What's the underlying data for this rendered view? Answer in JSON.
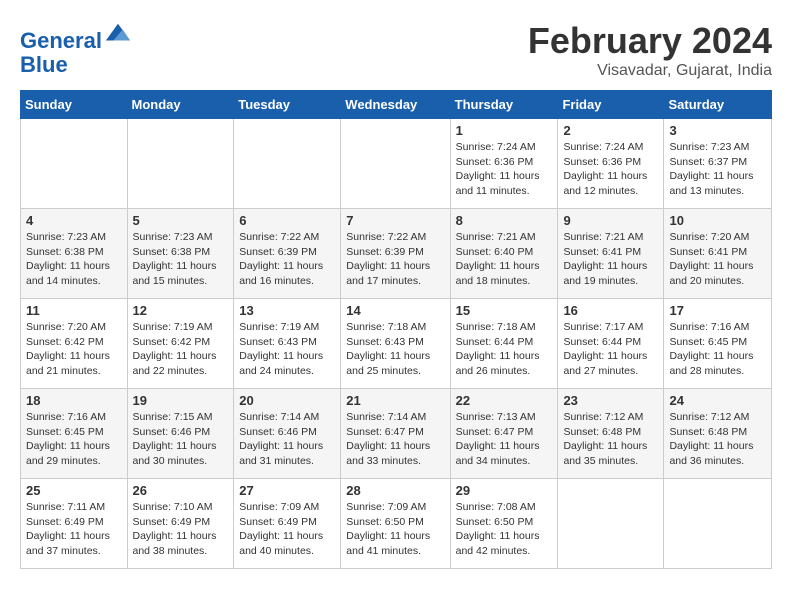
{
  "logo": {
    "line1": "General",
    "line2": "Blue"
  },
  "title": "February 2024",
  "location": "Visavadar, Gujarat, India",
  "days_of_week": [
    "Sunday",
    "Monday",
    "Tuesday",
    "Wednesday",
    "Thursday",
    "Friday",
    "Saturday"
  ],
  "weeks": [
    [
      {
        "day": "",
        "info": ""
      },
      {
        "day": "",
        "info": ""
      },
      {
        "day": "",
        "info": ""
      },
      {
        "day": "",
        "info": ""
      },
      {
        "day": "1",
        "info": "Sunrise: 7:24 AM\nSunset: 6:36 PM\nDaylight: 11 hours\nand 11 minutes."
      },
      {
        "day": "2",
        "info": "Sunrise: 7:24 AM\nSunset: 6:36 PM\nDaylight: 11 hours\nand 12 minutes."
      },
      {
        "day": "3",
        "info": "Sunrise: 7:23 AM\nSunset: 6:37 PM\nDaylight: 11 hours\nand 13 minutes."
      }
    ],
    [
      {
        "day": "4",
        "info": "Sunrise: 7:23 AM\nSunset: 6:38 PM\nDaylight: 11 hours\nand 14 minutes."
      },
      {
        "day": "5",
        "info": "Sunrise: 7:23 AM\nSunset: 6:38 PM\nDaylight: 11 hours\nand 15 minutes."
      },
      {
        "day": "6",
        "info": "Sunrise: 7:22 AM\nSunset: 6:39 PM\nDaylight: 11 hours\nand 16 minutes."
      },
      {
        "day": "7",
        "info": "Sunrise: 7:22 AM\nSunset: 6:39 PM\nDaylight: 11 hours\nand 17 minutes."
      },
      {
        "day": "8",
        "info": "Sunrise: 7:21 AM\nSunset: 6:40 PM\nDaylight: 11 hours\nand 18 minutes."
      },
      {
        "day": "9",
        "info": "Sunrise: 7:21 AM\nSunset: 6:41 PM\nDaylight: 11 hours\nand 19 minutes."
      },
      {
        "day": "10",
        "info": "Sunrise: 7:20 AM\nSunset: 6:41 PM\nDaylight: 11 hours\nand 20 minutes."
      }
    ],
    [
      {
        "day": "11",
        "info": "Sunrise: 7:20 AM\nSunset: 6:42 PM\nDaylight: 11 hours\nand 21 minutes."
      },
      {
        "day": "12",
        "info": "Sunrise: 7:19 AM\nSunset: 6:42 PM\nDaylight: 11 hours\nand 22 minutes."
      },
      {
        "day": "13",
        "info": "Sunrise: 7:19 AM\nSunset: 6:43 PM\nDaylight: 11 hours\nand 24 minutes."
      },
      {
        "day": "14",
        "info": "Sunrise: 7:18 AM\nSunset: 6:43 PM\nDaylight: 11 hours\nand 25 minutes."
      },
      {
        "day": "15",
        "info": "Sunrise: 7:18 AM\nSunset: 6:44 PM\nDaylight: 11 hours\nand 26 minutes."
      },
      {
        "day": "16",
        "info": "Sunrise: 7:17 AM\nSunset: 6:44 PM\nDaylight: 11 hours\nand 27 minutes."
      },
      {
        "day": "17",
        "info": "Sunrise: 7:16 AM\nSunset: 6:45 PM\nDaylight: 11 hours\nand 28 minutes."
      }
    ],
    [
      {
        "day": "18",
        "info": "Sunrise: 7:16 AM\nSunset: 6:45 PM\nDaylight: 11 hours\nand 29 minutes."
      },
      {
        "day": "19",
        "info": "Sunrise: 7:15 AM\nSunset: 6:46 PM\nDaylight: 11 hours\nand 30 minutes."
      },
      {
        "day": "20",
        "info": "Sunrise: 7:14 AM\nSunset: 6:46 PM\nDaylight: 11 hours\nand 31 minutes."
      },
      {
        "day": "21",
        "info": "Sunrise: 7:14 AM\nSunset: 6:47 PM\nDaylight: 11 hours\nand 33 minutes."
      },
      {
        "day": "22",
        "info": "Sunrise: 7:13 AM\nSunset: 6:47 PM\nDaylight: 11 hours\nand 34 minutes."
      },
      {
        "day": "23",
        "info": "Sunrise: 7:12 AM\nSunset: 6:48 PM\nDaylight: 11 hours\nand 35 minutes."
      },
      {
        "day": "24",
        "info": "Sunrise: 7:12 AM\nSunset: 6:48 PM\nDaylight: 11 hours\nand 36 minutes."
      }
    ],
    [
      {
        "day": "25",
        "info": "Sunrise: 7:11 AM\nSunset: 6:49 PM\nDaylight: 11 hours\nand 37 minutes."
      },
      {
        "day": "26",
        "info": "Sunrise: 7:10 AM\nSunset: 6:49 PM\nDaylight: 11 hours\nand 38 minutes."
      },
      {
        "day": "27",
        "info": "Sunrise: 7:09 AM\nSunset: 6:49 PM\nDaylight: 11 hours\nand 40 minutes."
      },
      {
        "day": "28",
        "info": "Sunrise: 7:09 AM\nSunset: 6:50 PM\nDaylight: 11 hours\nand 41 minutes."
      },
      {
        "day": "29",
        "info": "Sunrise: 7:08 AM\nSunset: 6:50 PM\nDaylight: 11 hours\nand 42 minutes."
      },
      {
        "day": "",
        "info": ""
      },
      {
        "day": "",
        "info": ""
      }
    ]
  ]
}
